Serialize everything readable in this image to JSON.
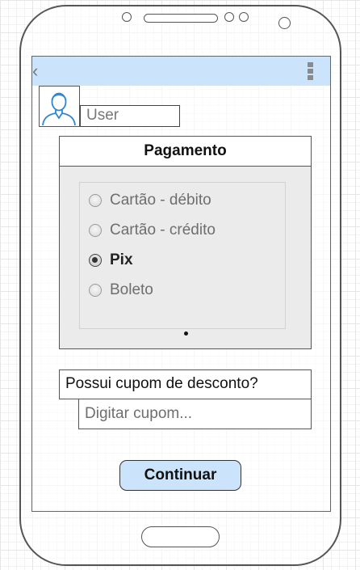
{
  "header": {
    "back_icon": "chevron-left-icon",
    "menu_icon": "kebab-menu-icon"
  },
  "user": {
    "avatar_icon": "user-avatar-icon",
    "name": "User"
  },
  "payment": {
    "title": "Pagamento",
    "options": [
      {
        "label": "Cartão - débito",
        "selected": false
      },
      {
        "label": "Cartão - crédito",
        "selected": false
      },
      {
        "label": "Pix",
        "selected": true
      },
      {
        "label": "Boleto",
        "selected": false
      }
    ]
  },
  "coupon": {
    "question": "Possui cupom de desconto?",
    "placeholder": "Digitar cupom...",
    "value": ""
  },
  "actions": {
    "continue_label": "Continuar"
  },
  "colors": {
    "accent": "#cce4fb",
    "border": "#555555",
    "panel": "#ebebeb"
  }
}
